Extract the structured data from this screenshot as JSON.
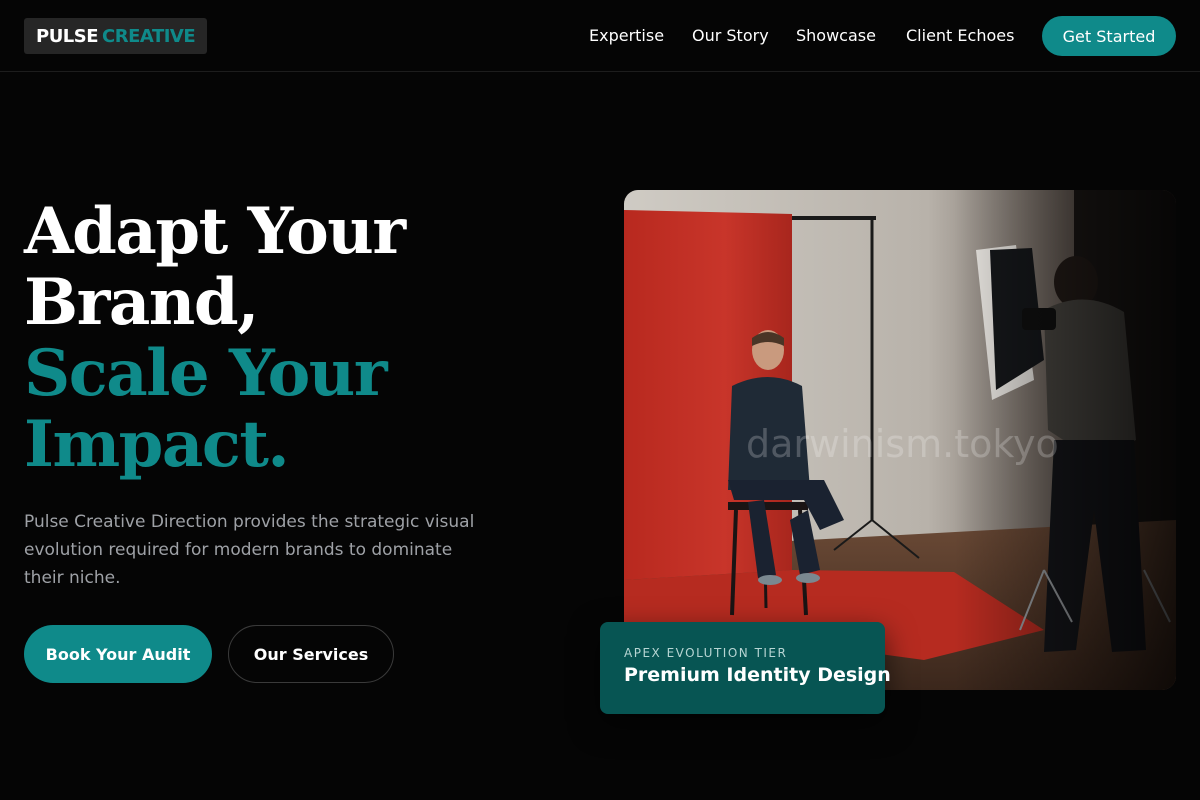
{
  "brand": {
    "part1": "PULSE",
    "part2": "CREATIVE"
  },
  "nav": {
    "items": [
      {
        "label": "Expertise"
      },
      {
        "label": "Our Story"
      },
      {
        "label": "Showcase"
      },
      {
        "label": "Client Echoes"
      }
    ],
    "cta_label": "Get Started"
  },
  "hero": {
    "headline_line1": "Adapt Your",
    "headline_line2": "Brand,",
    "headline_line3": "Scale Your",
    "headline_line4": "Impact.",
    "lead": "Pulse Creative Direction provides the strategic visual evolution required for modern brands to dominate their niche.",
    "primary_button": "Book Your Audit",
    "secondary_button": "Our Services"
  },
  "photo": {
    "watermark": "darwinism.tokyo"
  },
  "card": {
    "kicker": "APEX EVOLUTION TIER",
    "title": "Premium Identity Design"
  },
  "colors": {
    "background": "#050505",
    "accent": "#0f8a8a",
    "card": "#075553",
    "muted_text": "#9ea1a6"
  }
}
